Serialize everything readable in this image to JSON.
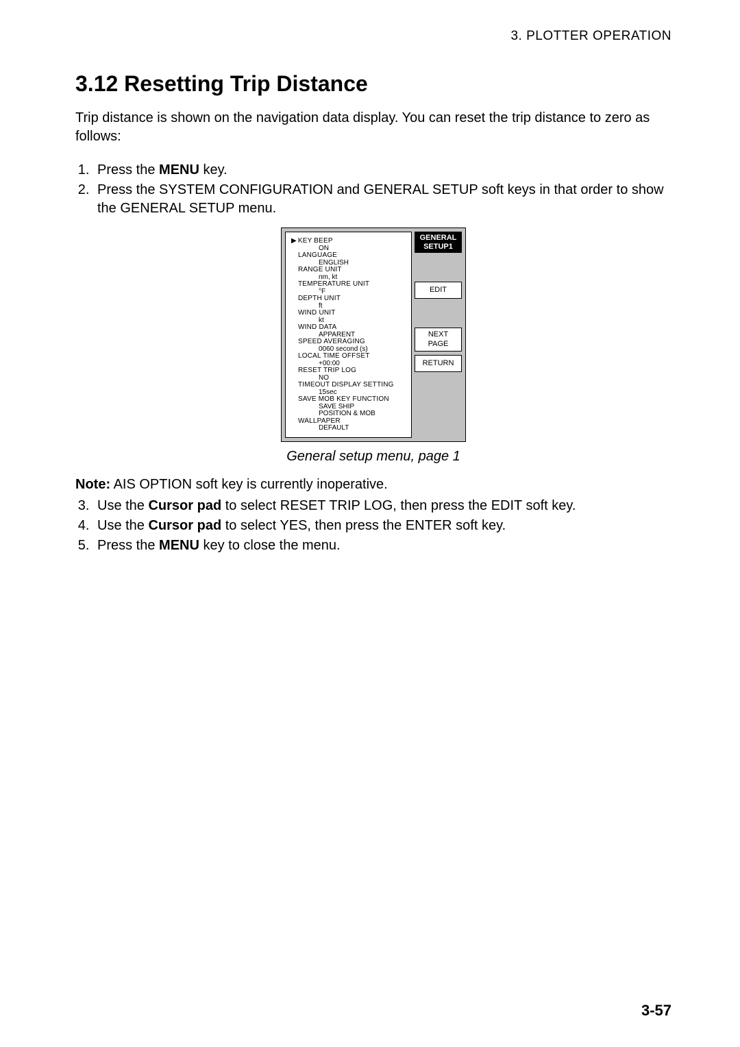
{
  "header": "3.  PLOTTER  OPERATION",
  "heading": "3.12  Resetting Trip Distance",
  "intro": "Trip distance is shown on the navigation data display. You can reset the trip distance to zero as follows:",
  "steps": {
    "s1a": "Press the ",
    "s1b": "MENU",
    "s1c": " key.",
    "s2": "Press the SYSTEM CONFIGURATION and GENERAL SETUP soft keys in that order to show the GENERAL SETUP menu."
  },
  "menu": {
    "title1": "GENERAL",
    "title2": "SETUP1",
    "soft_edit": "EDIT",
    "soft_next1": "NEXT",
    "soft_next2": "PAGE",
    "soft_return": "RETURN",
    "items": [
      {
        "label": "KEY BEEP",
        "value": "ON",
        "cursor": true
      },
      {
        "label": "LANGUAGE",
        "value": "ENGLISH"
      },
      {
        "label": "RANGE UNIT",
        "value": "nm, kt"
      },
      {
        "label": "TEMPERATURE UNIT",
        "value": "°F"
      },
      {
        "label": "DEPTH UNIT",
        "value": "ft"
      },
      {
        "label": "WIND UNIT",
        "value": "kt"
      },
      {
        "label": "WIND DATA",
        "value": "APPARENT"
      },
      {
        "label": "SPEED AVERAGING",
        "value": "0060 second (s)"
      },
      {
        "label": "LOCAL TIME OFFSET",
        "value": "+00:00"
      },
      {
        "label": "RESET TRIP LOG",
        "value": "NO"
      },
      {
        "label": "TIMEOUT DISPLAY SETTING",
        "value": "15sec"
      },
      {
        "label": "SAVE MOB KEY FUNCTION",
        "value": "SAVE SHIP",
        "value2": "POSITION & MOB"
      },
      {
        "label": "WALLPAPER",
        "value": "DEFAULT"
      }
    ]
  },
  "fig_caption": "General setup menu, page 1",
  "note_b": "Note:",
  "note_t": " AIS OPTION soft key is currently inoperative.",
  "steps2": {
    "s3a": "Use the ",
    "s3b": "Cursor pad",
    "s3c": " to select RESET TRIP LOG, then press the EDIT soft key.",
    "s4a": "Use the ",
    "s4b": "Cursor pad",
    "s4c": " to select YES, then press the ENTER soft key.",
    "s5a": "Press the ",
    "s5b": "MENU",
    "s5c": " key to close the menu."
  },
  "page_number": "3-57"
}
